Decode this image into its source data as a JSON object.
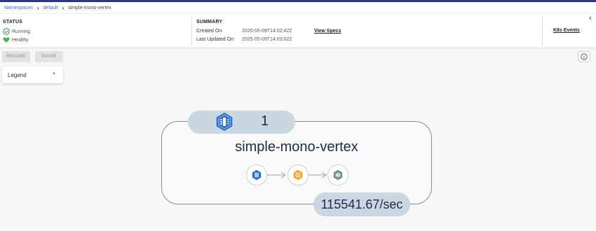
{
  "breadcrumb": {
    "items": [
      "Namespaces",
      "default",
      "simple-mono-vertex"
    ]
  },
  "status": {
    "title": "STATUS",
    "running": "Running",
    "healthy": "Healthy"
  },
  "summary": {
    "title": "SUMMARY",
    "created_label": "Created On:",
    "created_value": "2025-05-09T14:02:42Z",
    "updated_label": "Last Updated On:",
    "updated_value": "2025-05-09T14:03:02Z",
    "view_specs": "View Specs"
  },
  "k8s_events": "K8s Events",
  "toolbar": {
    "resume": "RESUME",
    "pause": "PAUSE"
  },
  "legend": {
    "label": "Legend"
  },
  "vertex": {
    "pod_count": "1",
    "name": "simple-mono-vertex",
    "rate": "115541.67/sec"
  },
  "colors": {
    "accent_blue": "#2f6fc4",
    "healthy_green": "#4caf50",
    "pill_bg": "#c9d7e3",
    "transformer_orange": "#f2a22a"
  },
  "icons": {
    "mono_vertex": "mono-vertex-icon",
    "source": "source-icon",
    "transformer": "transformer-icon",
    "sink": "sink-icon"
  }
}
